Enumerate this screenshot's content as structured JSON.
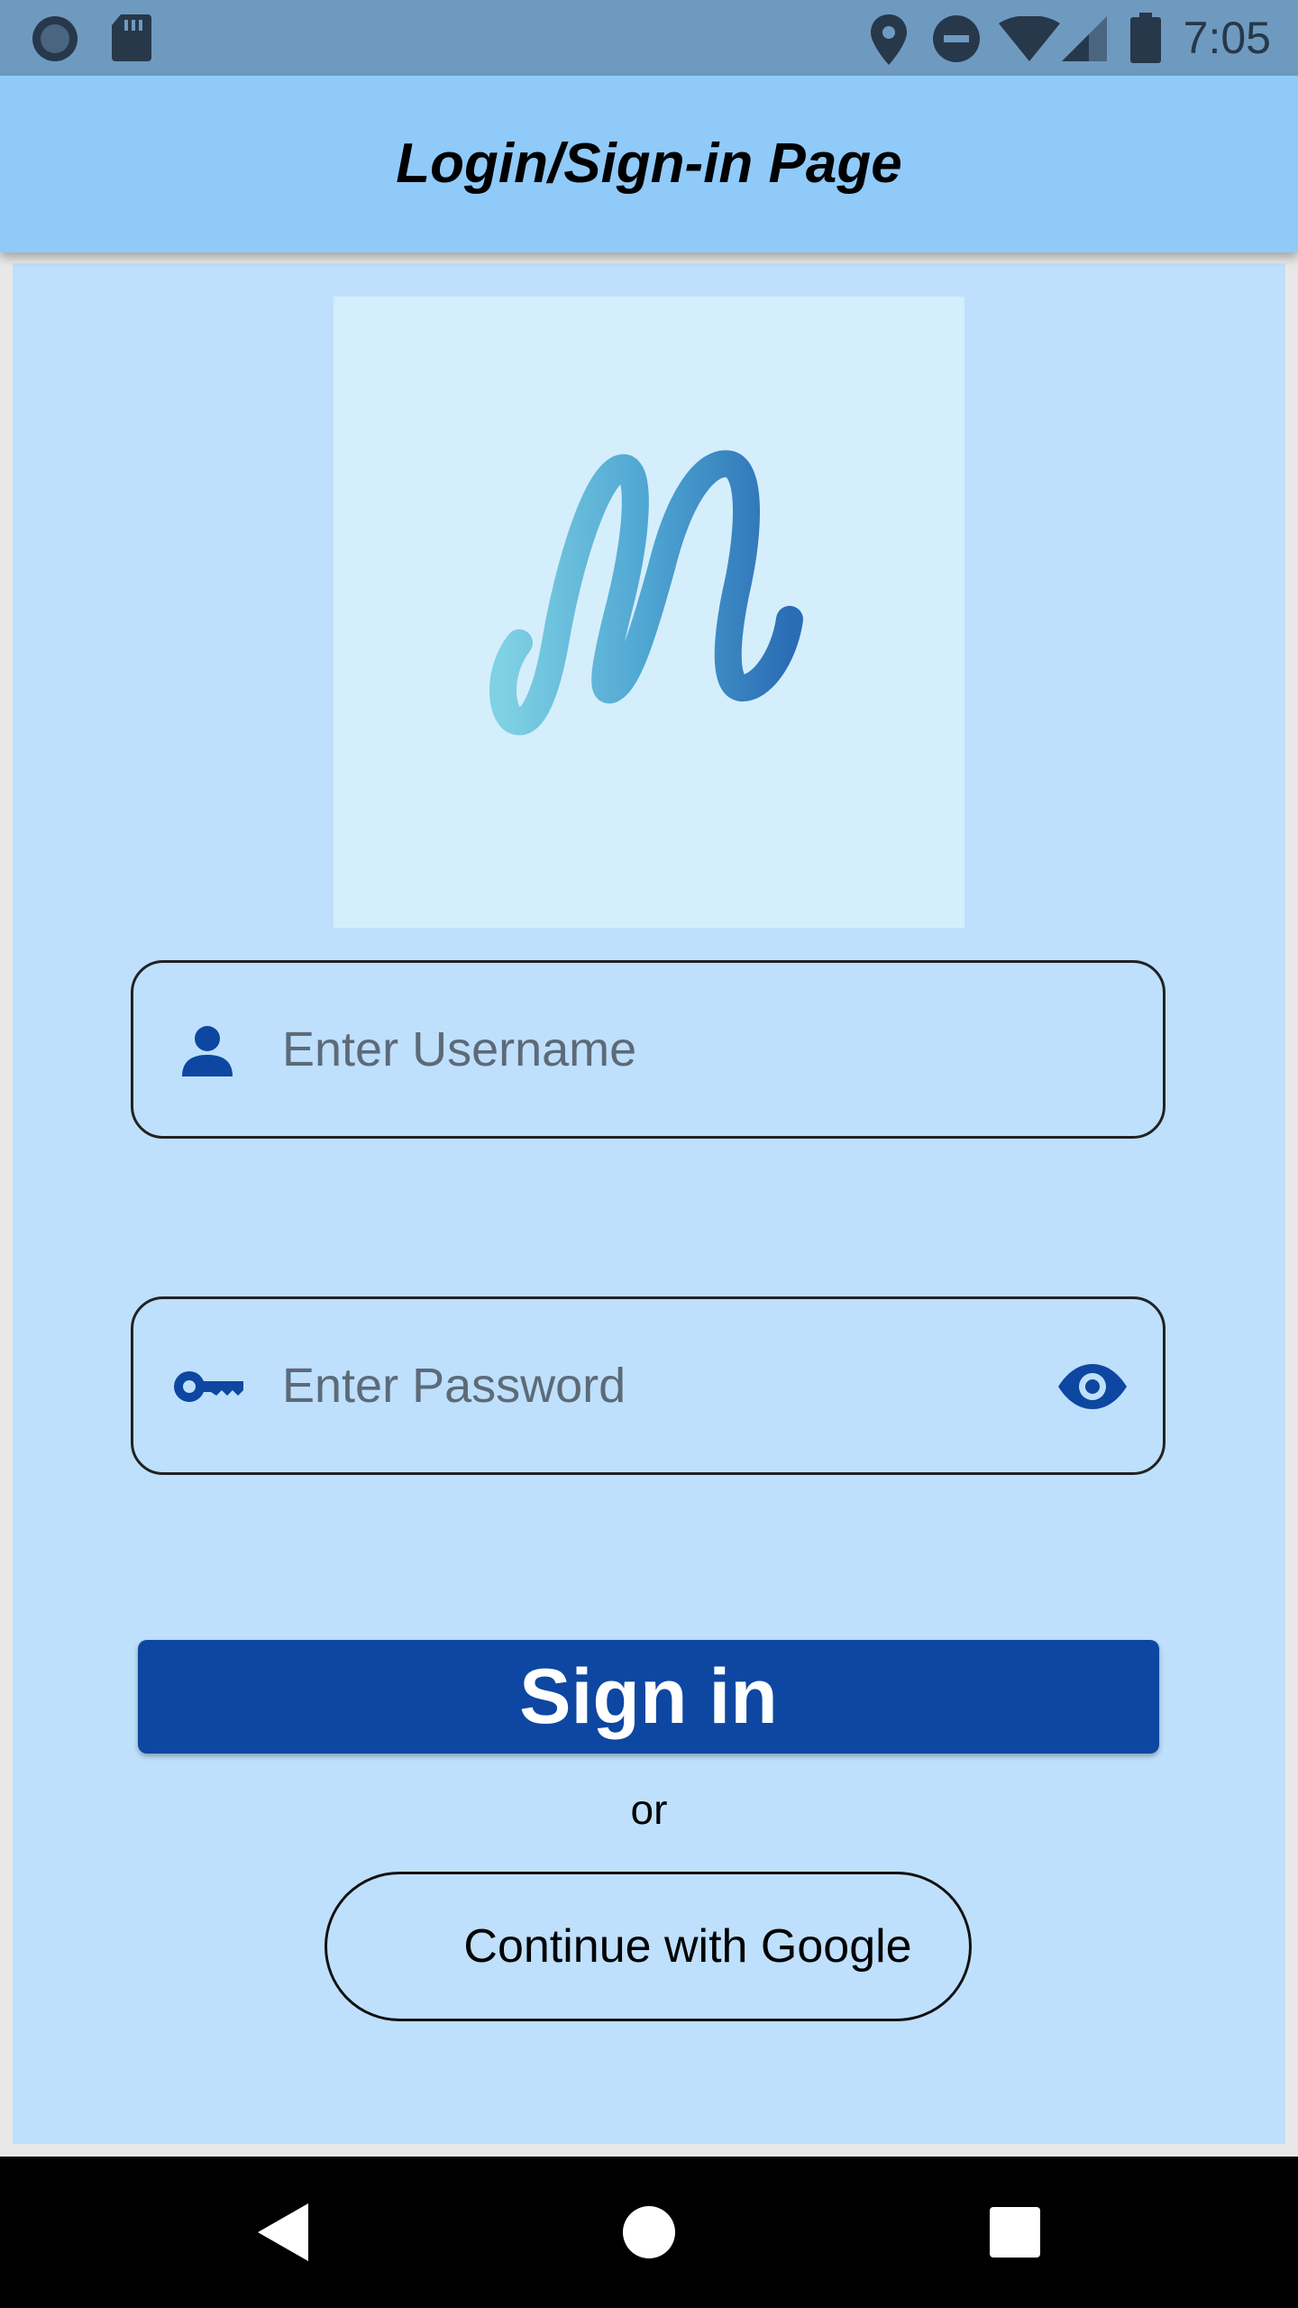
{
  "status_bar": {
    "time": "7:05",
    "left_icons": [
      "circle-record-icon",
      "sd-card-icon"
    ],
    "right_icons": [
      "location-pin-icon",
      "do-not-disturb-icon",
      "wifi-icon",
      "cell-signal-icon",
      "battery-icon"
    ]
  },
  "app_bar": {
    "title": "Login/Sign-in Page"
  },
  "logo": {
    "icon": "script-m-logo-icon"
  },
  "form": {
    "username": {
      "placeholder": "Enter Username",
      "icon": "person-icon"
    },
    "password": {
      "placeholder": "Enter Password",
      "icon": "key-icon",
      "toggle_icon": "eye-icon"
    },
    "signin_label": "Sign in",
    "or_label": "or",
    "google_label": "Continue with Google"
  },
  "nav_bar": {
    "icons": [
      "back-icon",
      "home-icon",
      "recents-icon"
    ]
  },
  "colors": {
    "status_bar": "#6f9ac0",
    "app_bar": "#90caf9",
    "background": "#bee0fc",
    "primary": "#0d47a1",
    "logo_bg": "#d5eefb"
  }
}
